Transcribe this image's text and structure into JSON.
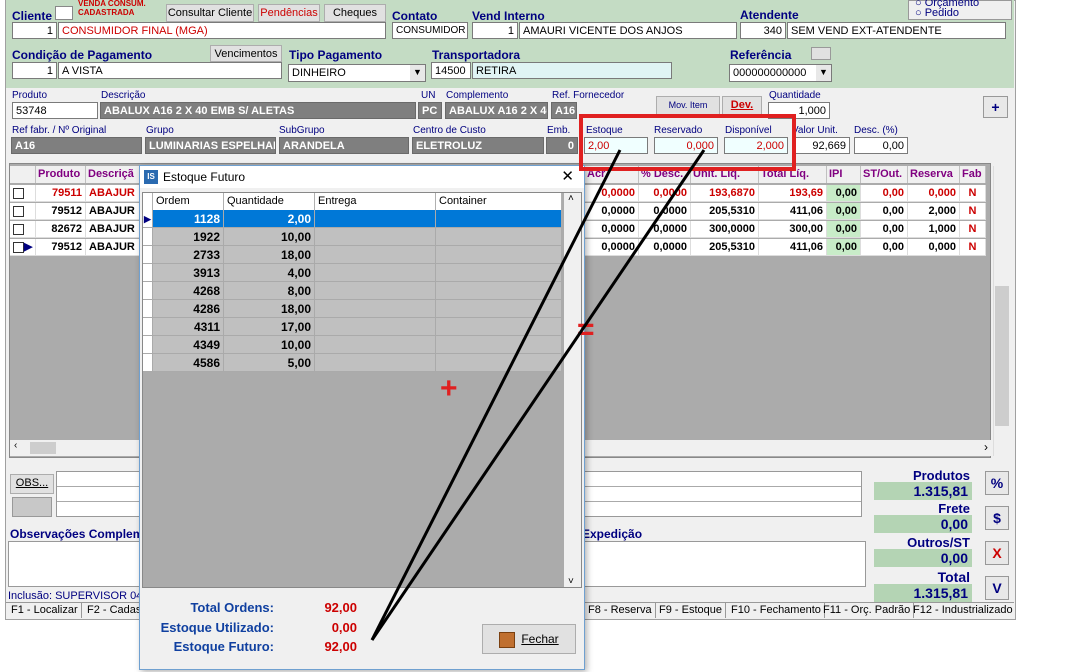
{
  "header": {
    "cliente_label": "Cliente",
    "venda_consum": "VENDA CONSUM.",
    "cadastrada": "CADASTRADA",
    "consultar_cliente": "Consultar Cliente",
    "pendencias": "Pendências",
    "cheques": "Cheques",
    "contato_label": "Contato",
    "vend_interno_label": "Vend Interno",
    "atendente_label": "Atendente",
    "orcamento": "Orçamento",
    "pedido": "Pedido",
    "cliente_code": "1",
    "cliente_name": "CONSUMIDOR FINAL (MGA)",
    "contato_value": "CONSUMIDOR",
    "vend_code": "1",
    "vend_name": "AMAURI VICENTE DOS ANJOS",
    "atend_code": "340",
    "atend_name": "SEM VEND EXT-ATENDENTE",
    "cond_pag_label": "Condição de Pagamento",
    "vencimentos": "Vencimentos",
    "tipo_pag_label": "Tipo Pagamento",
    "transportadora_label": "Transportadora",
    "referencia_label": "Referência",
    "cond_code": "1",
    "cond_name": "A VISTA",
    "tipo_pag_value": "DINHEIRO",
    "transp_code": "14500",
    "transp_name": "RETIRA",
    "referencia_value": "000000000000"
  },
  "product": {
    "produto_label": "Produto",
    "descricao_label": "Descrição",
    "un_label": "UN",
    "complemento_label": "Complemento",
    "ref_fornecedor_label": "Ref. Fornecedor",
    "quantidade_label": "Quantidade",
    "produto": "53748",
    "descricao": "ABALUX A16 2 X 40 EMB S/ ALETAS",
    "un": "PC",
    "complemento": "ABALUX A16 2 X 40",
    "ref_fornecedor": "A16",
    "mov_item": "Mov. Item",
    "dev": "Dev.",
    "quantidade": "1,000",
    "ref_fabr_label": "Ref fabr. / Nº Original",
    "grupo_label": "Grupo",
    "subgrupo_label": "SubGrupo",
    "centro_custo_label": "Centro de Custo",
    "emb_label": "Emb.",
    "estoque_label": "Estoque",
    "reservado_label": "Reservado",
    "disponivel_label": "Disponível",
    "valor_unit_label": "Valor Unit.",
    "desc_label": "Desc. (%)",
    "ref_fabr": "A16",
    "grupo": "LUMINARIAS ESPELHAD",
    "subgrupo": "ARANDELA",
    "centro_custo": "ELETROLUZ",
    "emb": "0",
    "estoque": "2,00",
    "reservado": "0,000",
    "disponivel": "2,000",
    "valor_unit": "92,669",
    "desc": "0,00"
  },
  "grid": {
    "headers": {
      "produto": "Produto",
      "descricao": "Descriçã",
      "acr": "Acr.",
      "desc": "% Desc.",
      "unit_liq": "Unit. Líq.",
      "total_liq": "Total Líq.",
      "ipi": "IPI",
      "st": "ST/Out.",
      "reserva": "Reserva",
      "fab": "Fab"
    },
    "rows": [
      {
        "produto": "79511",
        "descricao": "ABAJUR",
        "c0": "0",
        "acr": "0,0000",
        "desc": "0,0000",
        "unit": "193,6870",
        "total": "193,69",
        "ipi": "0,00",
        "st": "0,00",
        "reserva": "0,000",
        "fab": "N"
      },
      {
        "produto": "79512",
        "descricao": "ABAJUR",
        "c0": "0",
        "acr": "0,0000",
        "desc": "0,0000",
        "unit": "205,5310",
        "total": "411,06",
        "ipi": "0,00",
        "st": "0,00",
        "reserva": "2,000",
        "fab": "N"
      },
      {
        "produto": "82672",
        "descricao": "ABAJUR",
        "c0": "0",
        "acr": "0,0000",
        "desc": "0,0000",
        "unit": "300,0000",
        "total": "300,00",
        "ipi": "0,00",
        "st": "0,00",
        "reserva": "1,000",
        "fab": "N"
      },
      {
        "produto": "79512",
        "descricao": "ABAJUR",
        "c0": "0",
        "acr": "0,0000",
        "desc": "0,0000",
        "unit": "205,5310",
        "total": "411,06",
        "ipi": "0,00",
        "st": "0,00",
        "reserva": "0,000",
        "fab": "N"
      }
    ]
  },
  "bottom": {
    "obs_btn": "OBS...",
    "obs_compl_label": "Observações Compleme",
    "expedicao_label": "Expedição",
    "inclusao": "Inclusão: SUPERVISOR 04"
  },
  "totals": {
    "produtos_label": "Produtos",
    "produtos": "1.315,81",
    "frete_label": "Frete",
    "frete": "0,00",
    "outros_label": "Outros/ST",
    "outros": "0,00",
    "total_label": "Total",
    "total": "1.315,81"
  },
  "side_buttons": [
    "%",
    "$",
    "X",
    "V"
  ],
  "fkeys": [
    "F1 - Localizar",
    "F2 - Cadas",
    "F8 - Reserva",
    "F9 - Estoque",
    "F10 - Fechamento",
    "F11 - Orç. Padrão",
    "F12 - Industrializado"
  ],
  "dialog": {
    "title": "Estoque Futuro",
    "headers": {
      "ordem": "Ordem",
      "quantidade": "Quantidade",
      "entrega": "Entrega",
      "container": "Container"
    },
    "rows": [
      {
        "ordem": "1128",
        "quantidade": "2,00"
      },
      {
        "ordem": "1922",
        "quantidade": "10,00"
      },
      {
        "ordem": "2733",
        "quantidade": "18,00"
      },
      {
        "ordem": "3913",
        "quantidade": "4,00"
      },
      {
        "ordem": "4268",
        "quantidade": "8,00"
      },
      {
        "ordem": "4286",
        "quantidade": "18,00"
      },
      {
        "ordem": "4311",
        "quantidade": "17,00"
      },
      {
        "ordem": "4349",
        "quantidade": "10,00"
      },
      {
        "ordem": "4586",
        "quantidade": "5,00"
      }
    ],
    "total_ordens_label": "Total Ordens:",
    "total_ordens": "92,00",
    "estoque_utilizado_label": "Estoque Utilizado:",
    "estoque_utilizado": "0,00",
    "estoque_futuro_label": "Estoque Futuro:",
    "estoque_futuro": "92,00",
    "fechar": "Fechar"
  },
  "annotations": {
    "plus": "+",
    "equals": "=",
    "annotation_color": "#e02020"
  }
}
